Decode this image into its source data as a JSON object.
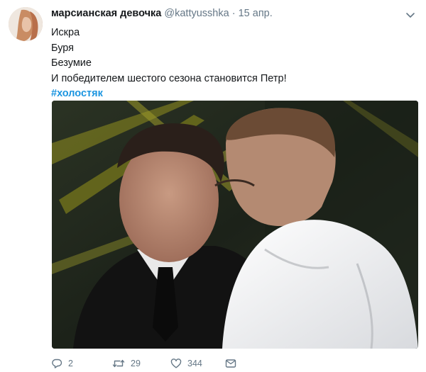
{
  "tweet": {
    "author_name": "марсианская девочка",
    "author_handle": "@kattyusshka",
    "separator": "·",
    "date": "15 апр.",
    "lines": [
      "Искра",
      "Буря",
      "Безумие",
      "И победителем шестого сезона становится Петр!"
    ],
    "hashtag": "#холостяк"
  },
  "actions": {
    "reply_count": "2",
    "retweet_count": "29",
    "like_count": "344"
  },
  "colors": {
    "link": "#1b95e0",
    "muted": "#657786",
    "text": "#14171a"
  }
}
